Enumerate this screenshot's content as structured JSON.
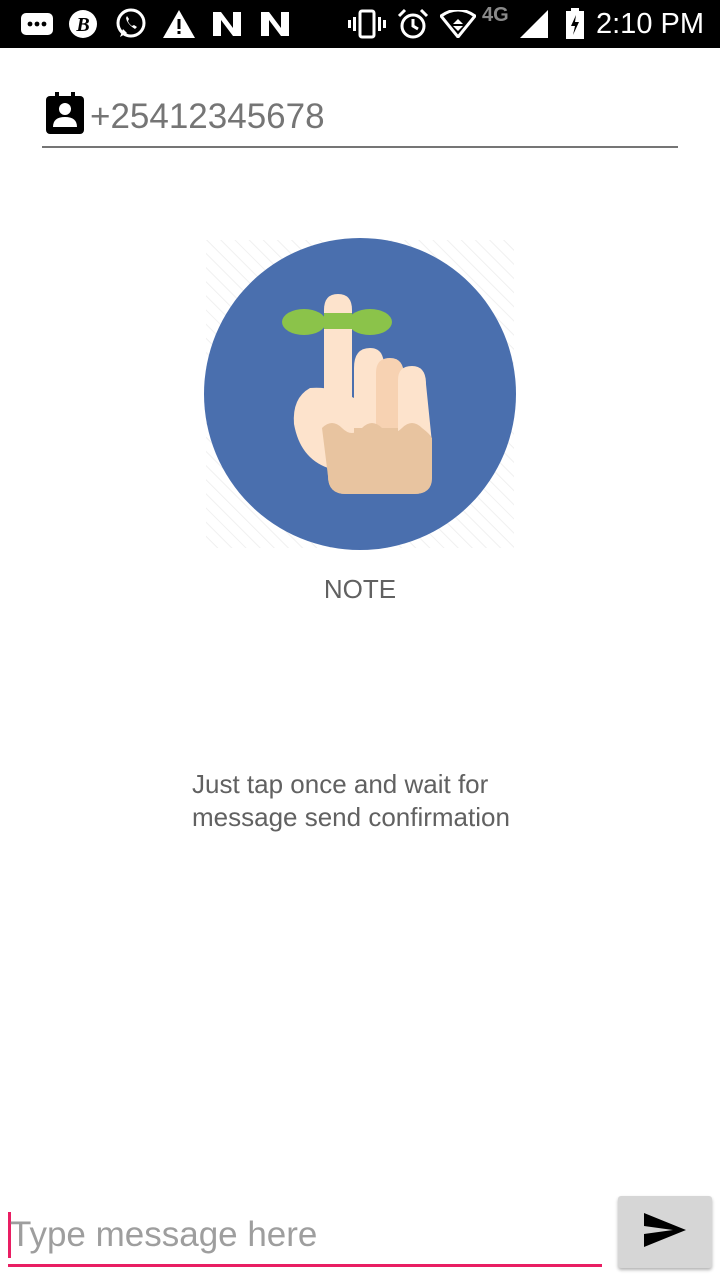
{
  "status_bar": {
    "time": "2:10 PM",
    "network_label": "4G",
    "icons": [
      "messages-icon",
      "b-app-icon",
      "whatsapp-icon",
      "warning-icon",
      "n-app-icon",
      "n-app-icon",
      "vibrate-icon",
      "alarm-icon",
      "wifi-icon",
      "signal-icon",
      "battery-icon"
    ]
  },
  "recipient": {
    "icon": "contact-icon",
    "placeholder": "+25412345678"
  },
  "note": {
    "illustration": "finger-ribbon-reminder-icon",
    "title": "NOTE",
    "instruction": "Just tap once and wait for message send confirmation"
  },
  "composer": {
    "placeholder": "Type message here",
    "send_icon": "send-icon"
  },
  "colors": {
    "accent": "#e91e63",
    "illustration_bg": "#4a6fae",
    "leaf_green": "#8bc34a",
    "skin_light": "#fde3cc",
    "skin_dark": "#e8c4a0"
  }
}
